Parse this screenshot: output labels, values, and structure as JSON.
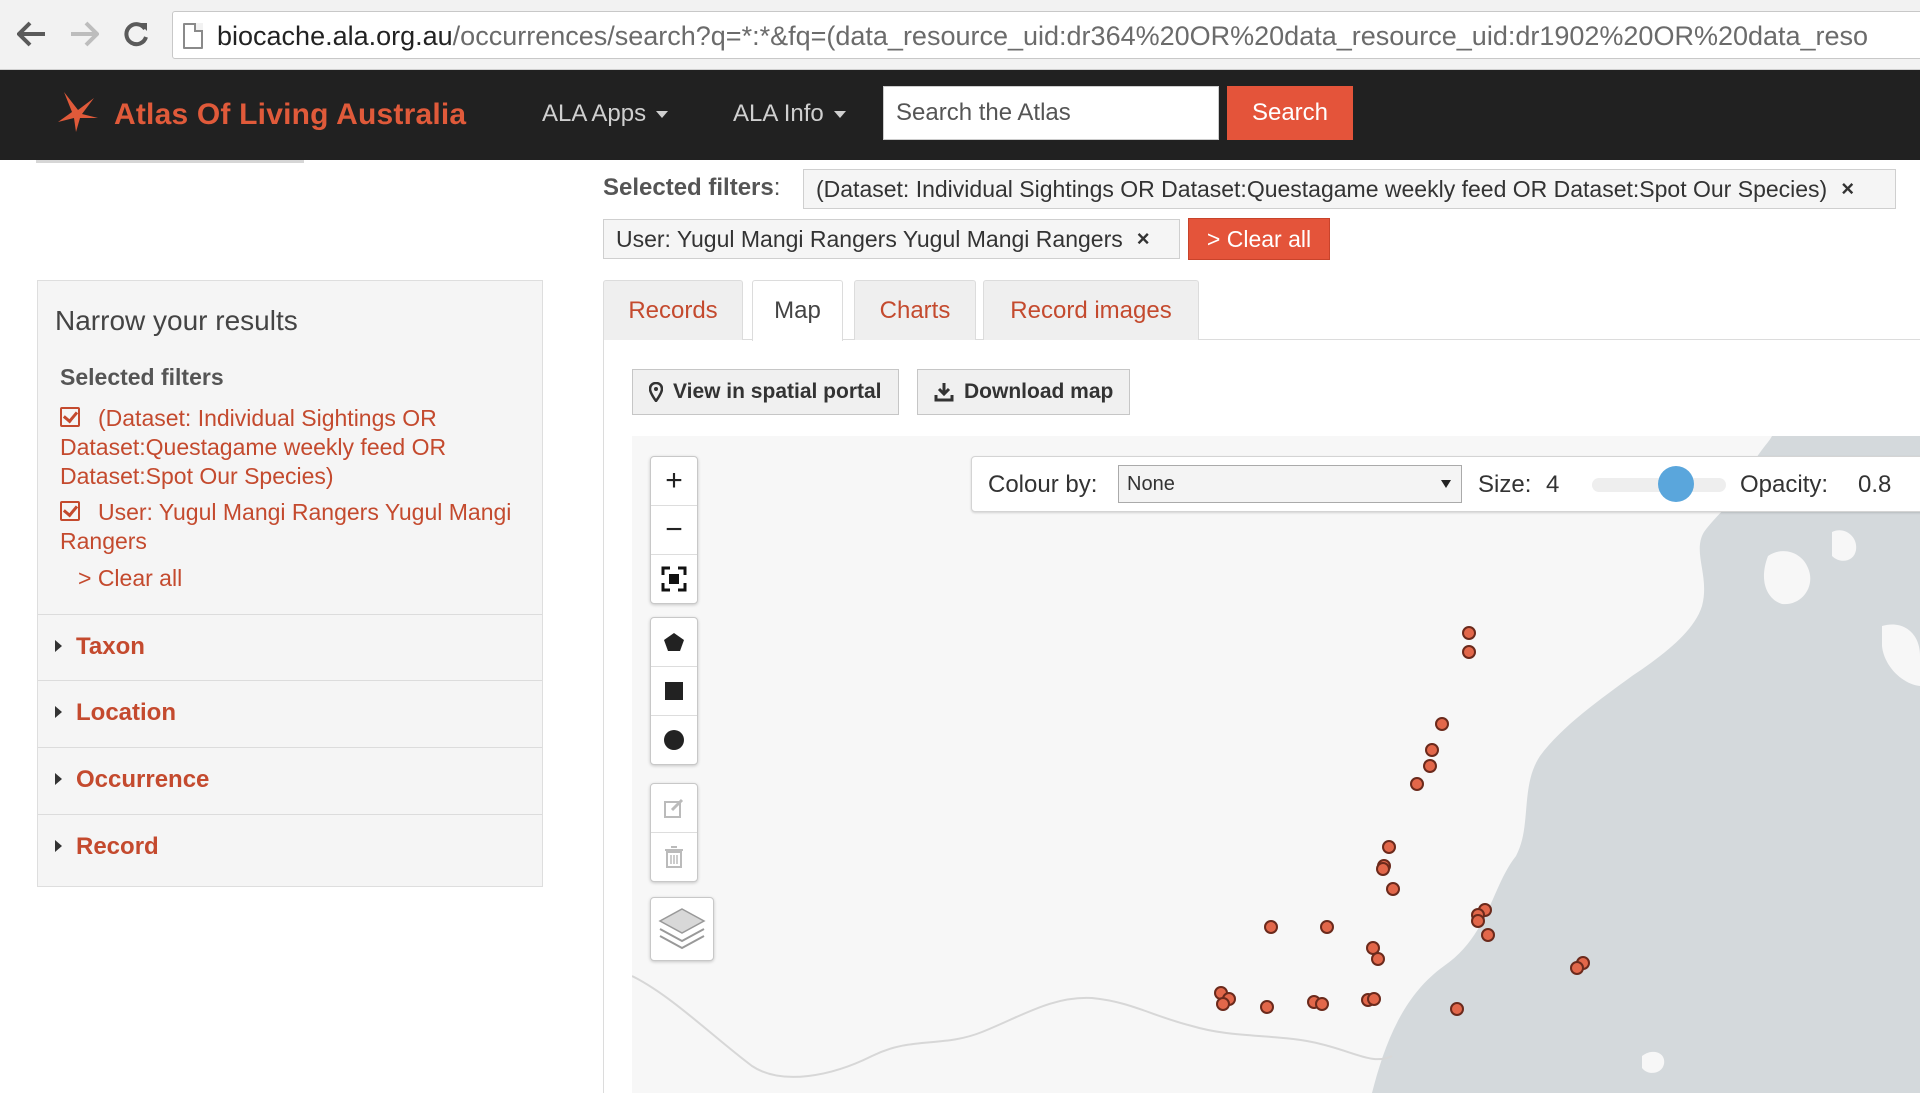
{
  "browser": {
    "url_host": "biocache.ala.org.au",
    "url_rest": "/occurrences/search?q=*:*&fq=(data_resource_uid:dr364%20OR%20data_resource_uid:dr1902%20OR%20data_reso"
  },
  "header": {
    "brand": "Atlas Of Living Australia",
    "menu_apps": "ALA Apps",
    "menu_info": "ALA Info",
    "search_placeholder": "Search the Atlas",
    "search_button": "Search"
  },
  "sidebar": {
    "title": "Narrow your results",
    "selected_filters_title": "Selected filters",
    "filters": [
      "(Dataset: Individual Sightings OR Dataset:Questagame weekly feed OR Dataset:Spot Our Species)",
      "User: Yugul Mangi Rangers Yugul Mangi Rangers"
    ],
    "clear_all": "> Clear all",
    "facets": [
      "Taxon",
      "Location",
      "Occurrence",
      "Record"
    ]
  },
  "main": {
    "selected_filters_label": "Selected filters",
    "chips": [
      "(Dataset: Individual Sightings OR Dataset:Questagame weekly feed OR Dataset:Spot Our Species)",
      "User: Yugul Mangi Rangers Yugul Mangi Rangers"
    ],
    "chip_close": "×",
    "clear_all_button": "> Clear all",
    "tabs": [
      "Records",
      "Map",
      "Charts",
      "Record images"
    ],
    "active_tab": "Map",
    "view_spatial": "View in spatial portal",
    "download_map": "Download map"
  },
  "map": {
    "colour_by_label": "Colour by:",
    "colour_by_value": "None",
    "size_label": "Size:",
    "size_value": "4",
    "opacity_label": "Opacity:",
    "opacity_value": "0.8",
    "point_color": "#e2674a",
    "water_color": "#d4d9dc",
    "land_color": "#f7f7f7"
  },
  "colors": {
    "accent": "#e4543a",
    "link": "#c44a2e",
    "header_bg": "#212121"
  }
}
